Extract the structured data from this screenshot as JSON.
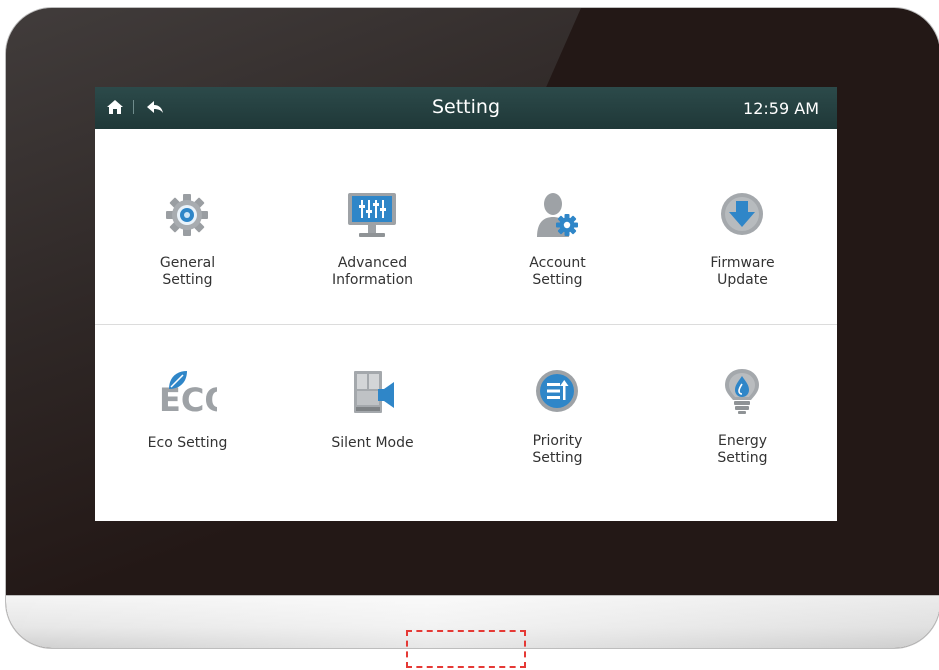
{
  "header": {
    "title": "Setting",
    "time": "12:59 AM"
  },
  "tiles_row1": [
    {
      "label": "General\nSetting",
      "icon": "gear-icon"
    },
    {
      "label": "Advanced\nInformation",
      "icon": "monitor-equalizer-icon"
    },
    {
      "label": "Account\nSetting",
      "icon": "user-gear-icon"
    },
    {
      "label": "Firmware\nUpdate",
      "icon": "download-arrow-icon"
    }
  ],
  "tiles_row2": [
    {
      "label": "Eco Setting",
      "icon": "eco-leaf-icon"
    },
    {
      "label": "Silent Mode",
      "icon": "silent-unit-icon"
    },
    {
      "label": "Priority\nSetting",
      "icon": "priority-list-icon"
    },
    {
      "label": "Energy\nSetting",
      "icon": "energy-bulb-icon"
    }
  ],
  "colors": {
    "header_bg": "#1f3838",
    "accent_blue": "#2f86c8",
    "icon_gray": "#8f9396"
  }
}
